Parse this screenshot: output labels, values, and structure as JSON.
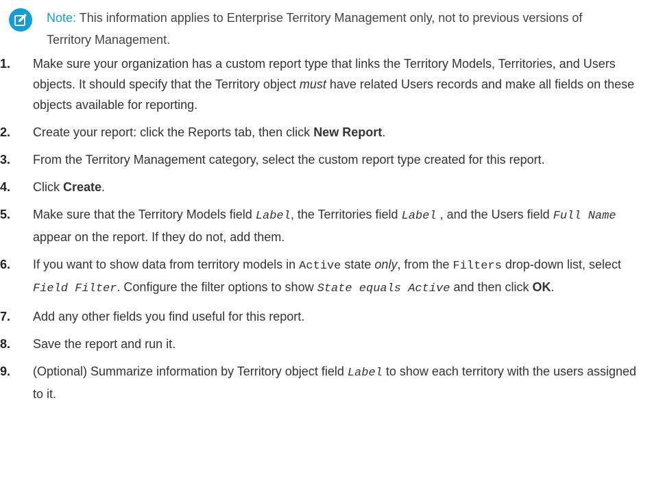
{
  "note": {
    "label": "Note:",
    "text": "This information applies to Enterprise Territory Management only, not to previous versions of Territory Management.",
    "icon": "edit-note-icon",
    "accent_color": "#0e9ed9"
  },
  "steps": [
    {
      "num": "1.",
      "parts": [
        "Make sure your organization has a custom report type that links the Territory Models, Territories, and Users objects. It should specify that the Territory object ",
        "must",
        " have related Users records and make all fields on these objects available for reporting."
      ]
    },
    {
      "num": "2.",
      "parts": [
        "Create your report: click the Reports tab, then click ",
        "New Report",
        "."
      ]
    },
    {
      "num": "3.",
      "parts": [
        "From the Territory Management category, select the custom report type created for this report."
      ]
    },
    {
      "num": "4.",
      "parts": [
        "Click ",
        "Create",
        "."
      ]
    },
    {
      "num": "5.",
      "parts": [
        "Make sure that the Territory Models field ",
        "Label",
        ", the Territories field ",
        "Label",
        " , and the Users field ",
        "Full Name",
        " appear on the report. If they do not, add them."
      ]
    },
    {
      "num": "6.",
      "parts": [
        "If you want to show data from territory models in ",
        "Active",
        " state ",
        "only",
        ", from the ",
        "Filters",
        " drop-down list, select ",
        "Field Filter",
        ". Configure the filter options to show ",
        "State equals Active",
        " and then click ",
        "OK",
        "."
      ]
    },
    {
      "num": "7.",
      "parts": [
        "Add any other fields you find useful for this report."
      ]
    },
    {
      "num": "8.",
      "parts": [
        "Save the report and run it."
      ]
    },
    {
      "num": "9.",
      "parts": [
        "(Optional) Summarize information by Territory object field ",
        "Label",
        " to show each territory with the users assigned to it."
      ]
    }
  ]
}
